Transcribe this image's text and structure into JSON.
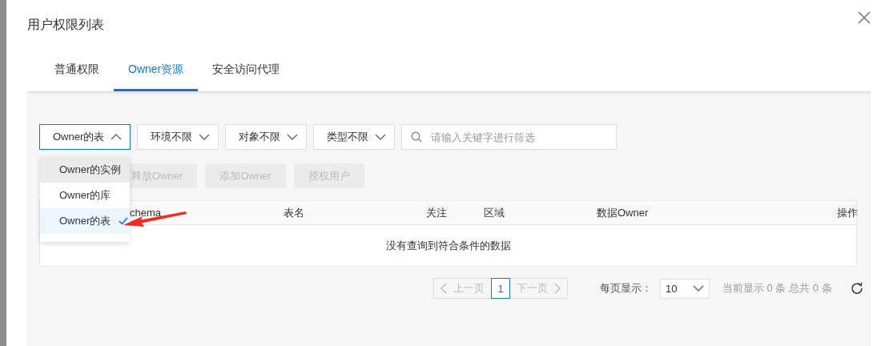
{
  "dialog": {
    "title": "用户权限列表"
  },
  "tabs": [
    {
      "label": "普通权限",
      "selected": false
    },
    {
      "label": "Owner资源",
      "selected": true
    },
    {
      "label": "安全访问代理",
      "selected": false
    }
  ],
  "filters": [
    {
      "label": "Owner的表",
      "open": true
    },
    {
      "label": "环境不限",
      "open": false
    },
    {
      "label": "对象不限",
      "open": false
    },
    {
      "label": "类型不限",
      "open": false
    }
  ],
  "search": {
    "placeholder": "请输入关键字进行筛选"
  },
  "dropdown_menu": {
    "items": [
      {
        "label": "Owner的实例",
        "hovered": true,
        "selected": false
      },
      {
        "label": "Owner的库",
        "hovered": false,
        "selected": false
      },
      {
        "label": "Owner的表",
        "hovered": false,
        "selected": true
      }
    ]
  },
  "buttons": [
    {
      "label": "释放Owner",
      "disabled": true
    },
    {
      "label": "添加Owner",
      "disabled": true
    },
    {
      "label": "授权用户",
      "disabled": true
    }
  ],
  "table": {
    "columns": [
      "chema",
      "表名",
      "关注",
      "区域",
      "数据Owner",
      "操作"
    ],
    "empty_text": "没有查询到符合条件的数据"
  },
  "pagination": {
    "prev": {
      "label": "上一页",
      "disabled": true
    },
    "pages": [
      {
        "label": "1",
        "selected": true
      }
    ],
    "next": {
      "label": "下一页",
      "disabled": true
    },
    "page_size_label": "每页显示：",
    "page_size": "10",
    "summary": "当前显示 0 条 总共 0 条"
  }
}
